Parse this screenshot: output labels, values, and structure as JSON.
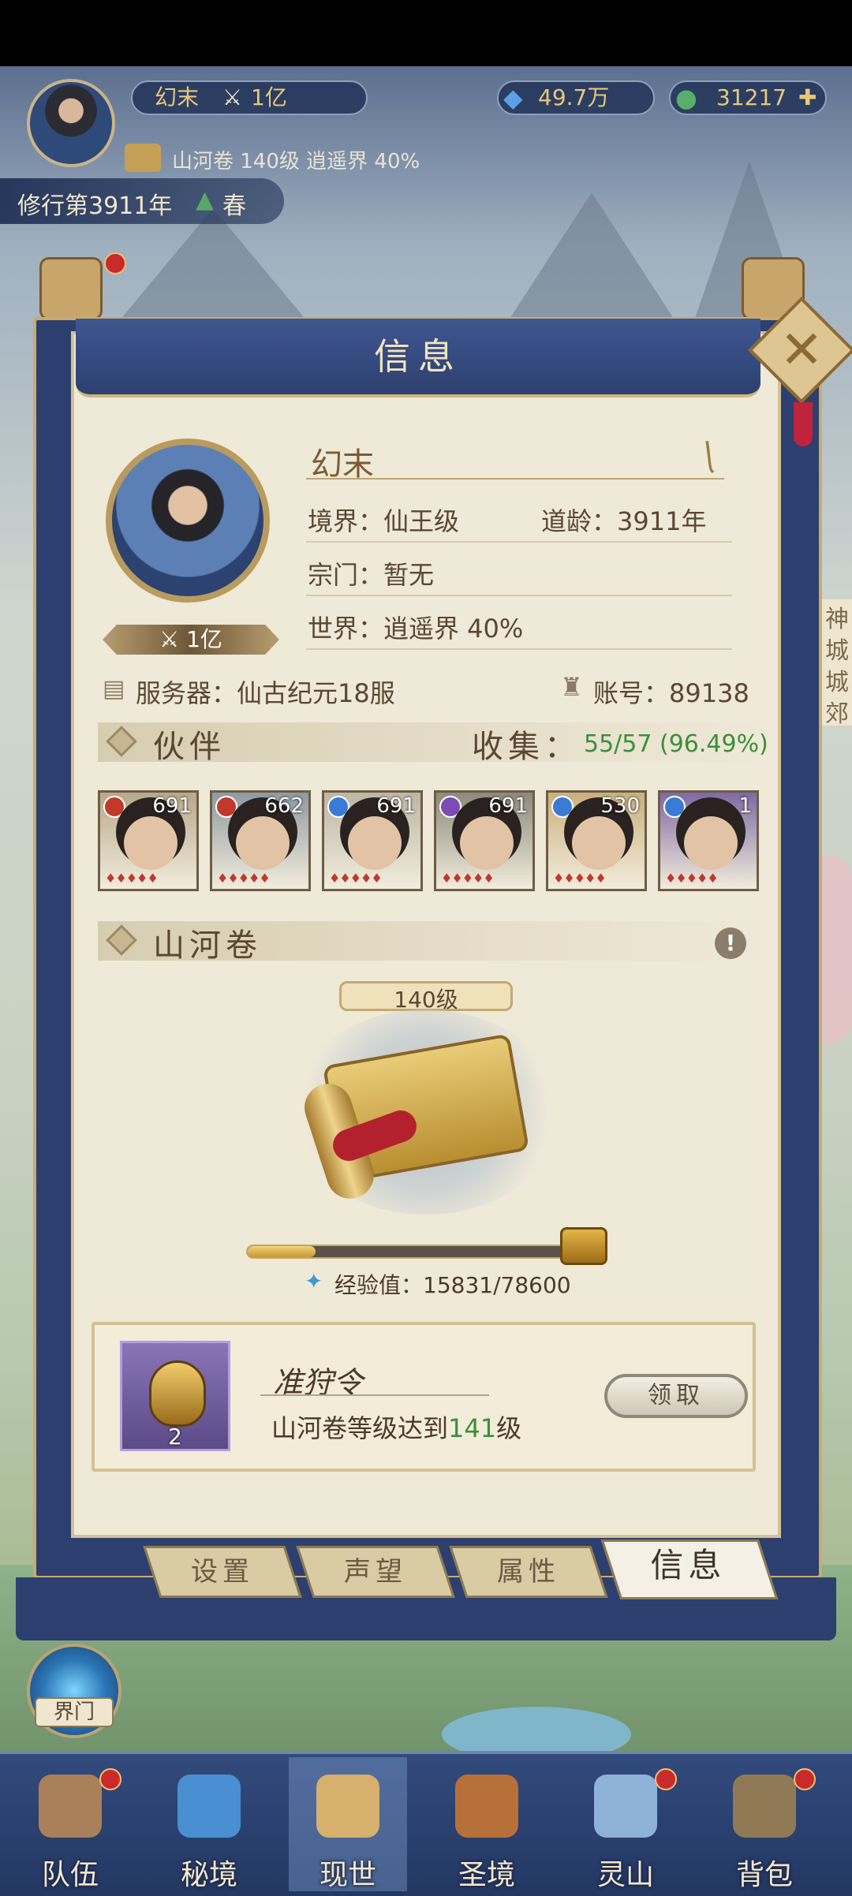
{
  "topbar": {
    "player_name": "幻末",
    "power": "1亿",
    "spirit_stones": "49.7万",
    "jade": "31217",
    "scroll_info": "山河卷 140级 逍遥界 40%",
    "cultivation_year": "修行第3911年",
    "season": "春"
  },
  "side": {
    "right_labels": [
      "神",
      "城",
      "城",
      "郊"
    ],
    "gate_label": "界门"
  },
  "panel": {
    "title": "信息",
    "close_icon": "✕",
    "profile": {
      "name": "幻末",
      "realm": "境界：仙王级",
      "dao_age": "道龄：3911年",
      "sect": "宗门：暂无",
      "world": "世界：逍遥界 40%",
      "power_badge": "1亿",
      "server": "服务器：仙古纪元18服",
      "account": "账号：89138"
    },
    "partners": {
      "title": "伙伴",
      "collect_label": "收集：",
      "collect_value": "55/57 (96.49%)",
      "cards": [
        {
          "level": "691",
          "element": "fire",
          "bg": "#b7a98a"
        },
        {
          "level": "662",
          "element": "fire",
          "bg": "#8f9aa3"
        },
        {
          "level": "691",
          "element": "wind",
          "bg": "#bdb6a2"
        },
        {
          "level": "691",
          "element": "void",
          "bg": "#8b8a7c"
        },
        {
          "level": "530",
          "element": "wind",
          "bg": "#c9b07d"
        },
        {
          "level": "1",
          "element": "wind",
          "bg": "#7e6aa3"
        }
      ]
    },
    "scroll": {
      "title": "山河卷",
      "level": "140级",
      "exp_label": "经验值：",
      "exp_value": "15831/78600",
      "exp_fraction": 0.2014
    },
    "reward": {
      "name": "准狩令",
      "count": "2",
      "desc_prefix": "山河卷等级达到",
      "desc_level": "141",
      "desc_suffix": "级",
      "claim": "领取"
    },
    "tabs": [
      "设置",
      "声望",
      "属性",
      "信息"
    ]
  },
  "nav": [
    {
      "label": "队伍",
      "icon": "team-icon",
      "dot": true
    },
    {
      "label": "秘境",
      "icon": "vortex-icon",
      "dot": false
    },
    {
      "label": "现世",
      "icon": "scroll-map-icon",
      "dot": false
    },
    {
      "label": "圣境",
      "icon": "temple-icon",
      "dot": false
    },
    {
      "label": "灵山",
      "icon": "mountain-icon",
      "dot": true
    },
    {
      "label": "背包",
      "icon": "bag-icon",
      "dot": true
    }
  ]
}
